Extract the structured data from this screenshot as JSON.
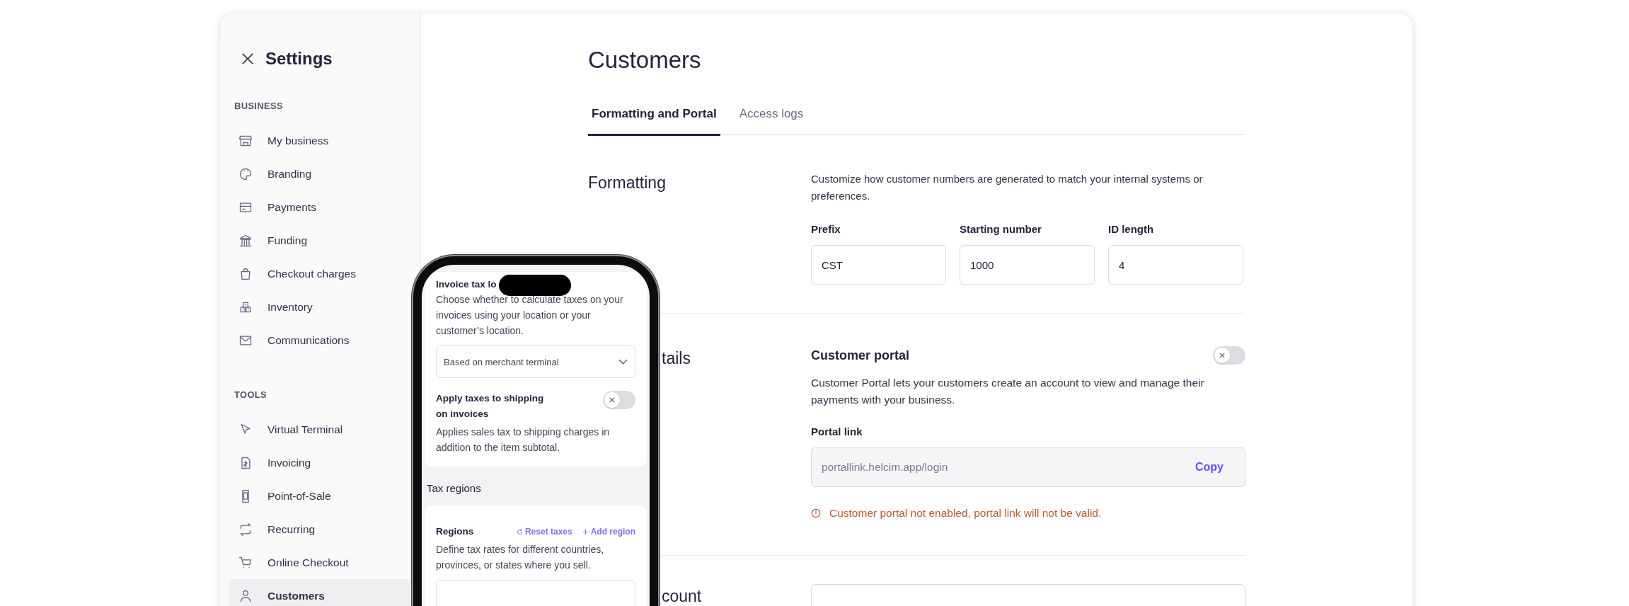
{
  "sidebar": {
    "title": "Settings",
    "sections": [
      {
        "heading": "BUSINESS",
        "items": [
          {
            "label": "My business",
            "selected": false
          },
          {
            "label": "Branding",
            "selected": false
          },
          {
            "label": "Payments",
            "selected": false
          },
          {
            "label": "Funding",
            "selected": false
          },
          {
            "label": "Checkout charges",
            "selected": false
          },
          {
            "label": "Inventory",
            "selected": false
          },
          {
            "label": "Communications",
            "selected": false
          }
        ]
      },
      {
        "heading": "TOOLS",
        "items": [
          {
            "label": "Virtual Terminal",
            "selected": false
          },
          {
            "label": "Invoicing",
            "selected": false
          },
          {
            "label": "Point-of-Sale",
            "selected": false
          },
          {
            "label": "Recurring",
            "selected": false
          },
          {
            "label": "Online Checkout",
            "selected": false
          },
          {
            "label": "Customers",
            "selected": true
          }
        ]
      }
    ]
  },
  "main": {
    "title": "Customers",
    "tabs": [
      {
        "label": "Formatting and Portal",
        "selected": true
      },
      {
        "label": "Access logs",
        "selected": false
      }
    ],
    "formatting": {
      "heading": "Formatting",
      "description": "Customize how customer numbers are generated to match your internal systems or preferences.",
      "fields": [
        {
          "label": "Prefix",
          "value": "CST"
        },
        {
          "label": "Starting number",
          "value": "1000"
        },
        {
          "label": "ID length",
          "value": "4"
        }
      ]
    },
    "details": {
      "heading": "tails",
      "portal_title": "Customer portal",
      "portal_on": false,
      "description": "Customer Portal lets your customers create an account to view and manage their payments with your business.",
      "link_label": "Portal link",
      "link_value": "portallink.helcim.app/login",
      "copy": "Copy",
      "warning": "Customer portal not enabled, portal link will not be valid."
    },
    "account": {
      "heading": "count"
    }
  },
  "phone": {
    "card_title": "Invoice tax lo",
    "card_description": "Choose whether to calculate taxes on your invoices using your location or your customer’s location.",
    "select_value": "Based on merchant terminal",
    "shipping_title": "Apply taxes to shipping on invoices",
    "shipping_on": false,
    "shipping_description": "Applies sales tax to shipping charges in addition to the item subtotal.",
    "section_title": "Tax regions",
    "regions_title": "Regions",
    "reset": "Reset taxes",
    "add": "Add region",
    "regions_description": "Define tax rates for different countries, provinces, or states where you sell."
  }
}
